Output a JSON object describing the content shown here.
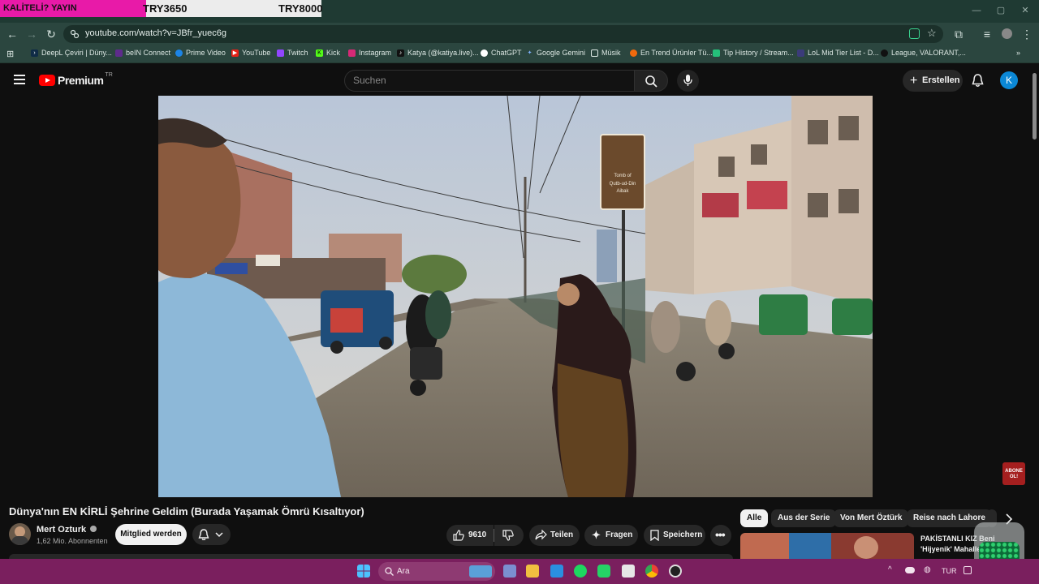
{
  "overlay": {
    "left_text": "KALİTELİ? YAYIN",
    "price1": "TRY3650",
    "price2": "TRY8000"
  },
  "browser": {
    "url": "youtube.com/watch?v=JBfr_yuec6g",
    "bookmarks": [
      "DeepL Çeviri | Düny...",
      "beIN Connect",
      "Prime Video",
      "YouTube",
      "Twitch",
      "Kick",
      "Instagram",
      "Katya (@katiya.live)...",
      "ChatGPT",
      "Google Gemini",
      "Müsik",
      "En Trend Ürünler Tü...",
      "Tip History / Stream...",
      "LoL Mid Tier List - D...",
      "League, VALORANT,..."
    ]
  },
  "youtube": {
    "logo_text": "Premium",
    "logo_region": "TR",
    "search_placeholder": "Suchen",
    "create_label": "Erstellen",
    "avatar_letter": "K"
  },
  "video": {
    "sign_text": "Tomb of Qutb-ud-Din Aibak",
    "title": "Dünya'nın EN KİRLİ Şehrine Geldim (Burada Yaşamak Ömrü Kısaltıyor)",
    "overlay_badge": "ABONE OL!"
  },
  "channel": {
    "name": "Mert Ozturk",
    "subscribers": "1,62 Mio. Abonnenten",
    "member_label": "Mitglied werden"
  },
  "actions": {
    "likes": "9610",
    "share": "Teilen",
    "ask": "Fragen",
    "save": "Speichern"
  },
  "chips": [
    "Alle",
    "Aus der Serie",
    "Von Mert Öztürk",
    "Reise nach Lahore"
  ],
  "recommendation": {
    "title_line1": "PAKİSTANLI KIZ Beni",
    "title_line2": "'Hijyenik' Mahalle..."
  },
  "taskbar": {
    "search_label": "Ara",
    "language": "TUR"
  }
}
